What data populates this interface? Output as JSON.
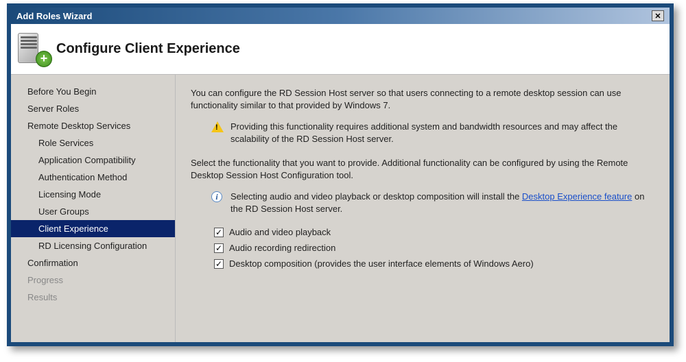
{
  "window": {
    "title": "Add Roles Wizard"
  },
  "header": {
    "title": "Configure Client Experience"
  },
  "sidebar": {
    "items": [
      {
        "label": "Before You Begin",
        "level": 0,
        "selected": false,
        "disabled": false
      },
      {
        "label": "Server Roles",
        "level": 0,
        "selected": false,
        "disabled": false
      },
      {
        "label": "Remote Desktop Services",
        "level": 0,
        "selected": false,
        "disabled": false
      },
      {
        "label": "Role Services",
        "level": 1,
        "selected": false,
        "disabled": false
      },
      {
        "label": "Application Compatibility",
        "level": 1,
        "selected": false,
        "disabled": false
      },
      {
        "label": "Authentication Method",
        "level": 1,
        "selected": false,
        "disabled": false
      },
      {
        "label": "Licensing Mode",
        "level": 1,
        "selected": false,
        "disabled": false
      },
      {
        "label": "User Groups",
        "level": 1,
        "selected": false,
        "disabled": false
      },
      {
        "label": "Client Experience",
        "level": 1,
        "selected": true,
        "disabled": false
      },
      {
        "label": "RD Licensing Configuration",
        "level": 1,
        "selected": false,
        "disabled": false
      },
      {
        "label": "Confirmation",
        "level": 0,
        "selected": false,
        "disabled": false
      },
      {
        "label": "Progress",
        "level": 0,
        "selected": false,
        "disabled": true
      },
      {
        "label": "Results",
        "level": 0,
        "selected": false,
        "disabled": true
      }
    ]
  },
  "main": {
    "intro": "You can configure the RD Session Host server so that users connecting to a remote desktop session can use functionality similar to that provided by Windows 7.",
    "warning": "Providing this functionality requires additional system and bandwidth resources and may affect the scalability of the RD Session Host server.",
    "instruction": "Select the functionality that you want to provide. Additional functionality can be configured by using the Remote Desktop Session Host Configuration tool.",
    "info_pre": "Selecting audio and video playback or desktop composition will install the ",
    "info_link": "Desktop Experience feature",
    "info_post": " on the RD Session Host server.",
    "checkboxes": [
      {
        "label": "Audio and video playback",
        "checked": true
      },
      {
        "label": "Audio recording redirection",
        "checked": true
      },
      {
        "label": "Desktop composition (provides the user interface elements of Windows Aero)",
        "checked": true
      }
    ]
  }
}
